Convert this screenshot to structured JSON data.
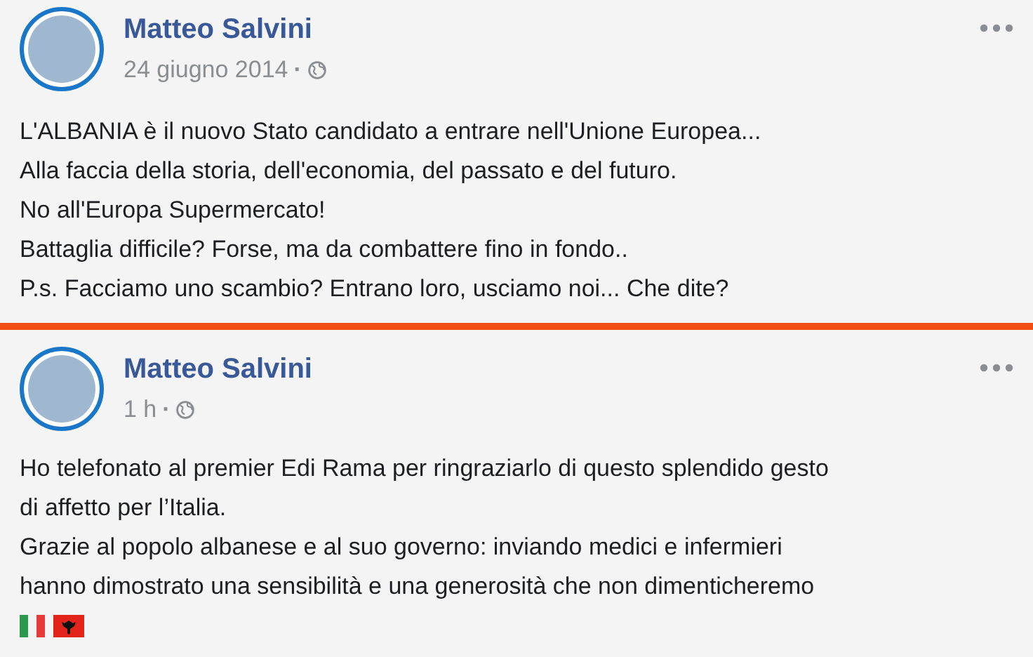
{
  "posts": [
    {
      "author": "Matteo Salvini",
      "time": "24 giugno 2014",
      "separator": "·",
      "lines": [
        "L'ALBANIA è il nuovo Stato candidato a entrare nell'Unione Europea...",
        "Alla faccia della storia, dell'economia, del passato e del futuro.",
        "No all'Europa Supermercato!",
        "Battaglia difficile? Forse, ma da combattere fino in fondo..",
        "P.s. Facciamo uno scambio? Entrano loro, usciamo noi... Che dite?"
      ],
      "flags": false
    },
    {
      "author": "Matteo Salvini",
      "time": "1 h",
      "separator": "·",
      "lines": [
        "Ho telefonato al premier Edi Rama per ringraziarlo di questo splendido gesto",
        "di affetto per l’Italia.",
        "Grazie al popolo albanese e al suo governo: inviando medici e infermieri",
        "hanno dimostrato una sensibilità e una generosità che non dimenticheremo"
      ],
      "flags": true
    }
  ]
}
